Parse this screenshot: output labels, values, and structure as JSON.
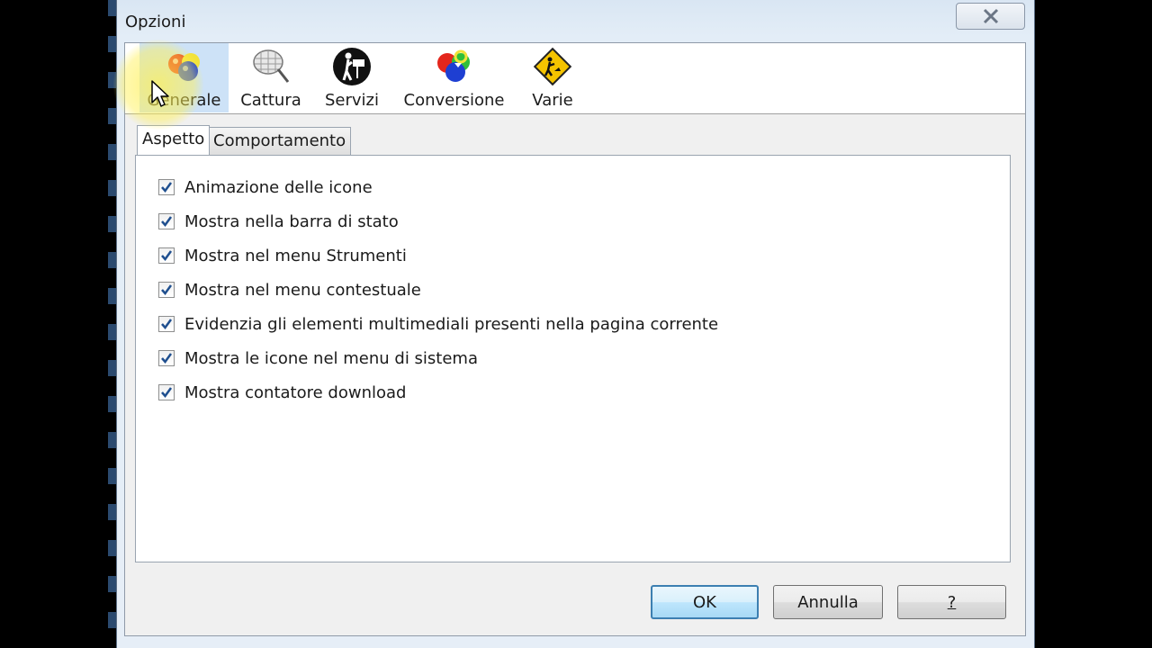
{
  "window": {
    "title": "Opzioni"
  },
  "toolbar": {
    "items": [
      {
        "label": "Generale",
        "icon": "color-balls-icon",
        "active": true
      },
      {
        "label": "Cattura",
        "icon": "net-icon"
      },
      {
        "label": "Servizi",
        "icon": "person-sign-icon"
      },
      {
        "label": "Conversione",
        "icon": "color-balls-arrow-icon"
      },
      {
        "label": "Varie",
        "icon": "warning-sign-icon"
      }
    ]
  },
  "tabs": [
    {
      "label": "Aspetto",
      "selected": true
    },
    {
      "label": "Comportamento",
      "selected": false
    }
  ],
  "options": [
    {
      "label": "Animazione delle icone",
      "checked": true
    },
    {
      "label": "Mostra nella barra di stato",
      "checked": true
    },
    {
      "label": "Mostra nel menu Strumenti",
      "checked": true
    },
    {
      "label": "Mostra nel menu contestuale",
      "checked": true
    },
    {
      "label": "Evidenzia gli elementi multimediali presenti nella pagina corrente",
      "checked": true
    },
    {
      "label": "Mostra le icone nel menu di sistema",
      "checked": true
    },
    {
      "label": "Mostra contatore download",
      "checked": true
    }
  ],
  "buttons": {
    "ok": "OK",
    "cancel": "Annulla",
    "help": "?"
  },
  "colors": {
    "accent": "#3c7fb1",
    "active_toolbar": "#cde2f7",
    "check": "#1f4f8f"
  }
}
